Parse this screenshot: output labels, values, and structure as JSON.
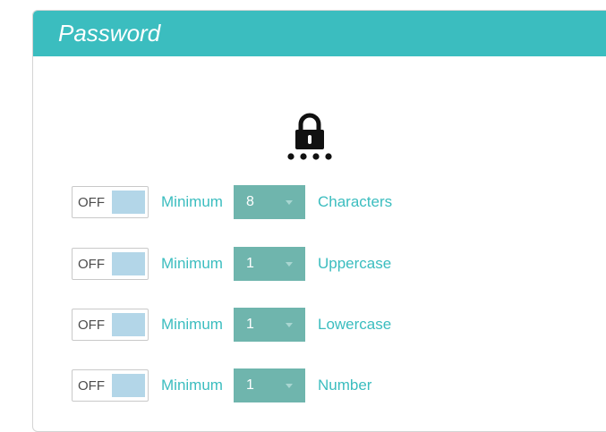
{
  "panel": {
    "title": "Password",
    "accent_color": "#3bbdbf",
    "icon": "lock-with-password-dots-icon"
  },
  "rules": [
    {
      "toggle": "OFF",
      "prefix": "Minimum",
      "value": "8",
      "type": "Characters"
    },
    {
      "toggle": "OFF",
      "prefix": "Minimum",
      "value": "1",
      "type": "Uppercase"
    },
    {
      "toggle": "OFF",
      "prefix": "Minimum",
      "value": "1",
      "type": "Lowercase"
    },
    {
      "toggle": "OFF",
      "prefix": "Minimum",
      "value": "1",
      "type": "Number"
    }
  ]
}
